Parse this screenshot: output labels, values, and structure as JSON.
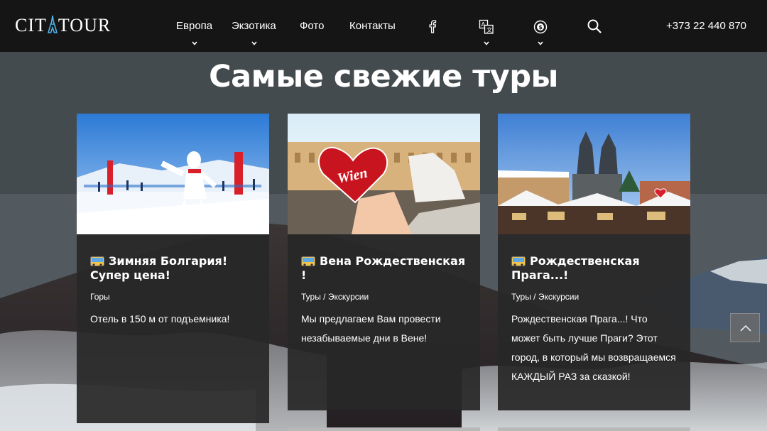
{
  "header": {
    "logo": "CITYTOUR",
    "nav": [
      {
        "label": "Европа",
        "has_dropdown": true
      },
      {
        "label": "Экзотика",
        "has_dropdown": true
      },
      {
        "label": "Фото",
        "has_dropdown": false
      },
      {
        "label": "Контакты",
        "has_dropdown": false
      }
    ],
    "icons": [
      "facebook-icon",
      "language-icon",
      "currency-icon",
      "search-icon"
    ],
    "phone": "+373 22 440 870"
  },
  "section": {
    "title": "Самые свежие туры"
  },
  "cards": [
    {
      "title": "Зимняя Болгария! Супер цена!",
      "category": "Горы",
      "description": "Отель в 150 м от подъемника!",
      "icon": "bus-icon"
    },
    {
      "title": "Вена Рождественская !",
      "category": "Туры / Экскурсии",
      "description": "Мы предлагаем Вам провести незабываемые дни в Вене!",
      "icon": "bus-icon",
      "photo_sign": "Wien"
    },
    {
      "title": "Рождественская Прага...!",
      "category": "Туры / Экскурсии",
      "description": "Рождественская Прага...! Что может быть лучше Праги? Этот город, в который мы возвращаемся КАЖДЫЙ РАЗ за сказкой!",
      "icon": "bus-icon"
    }
  ],
  "colors": {
    "header_bg": "#151515",
    "card_bg": "#282828",
    "text": "#ffffff"
  }
}
